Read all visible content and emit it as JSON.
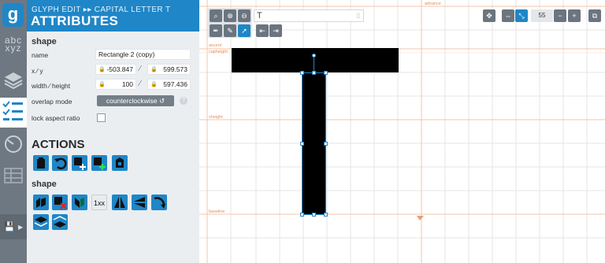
{
  "rail": {
    "logo": "g",
    "items": [
      "abc xyz",
      "layers",
      "attributes",
      "guides",
      "kerning",
      "save"
    ]
  },
  "header": {
    "breadcrumb": "GLYPH EDIT  ▸▸  CAPITAL LETTER T",
    "title": "ATTRIBUTES"
  },
  "shape_section": {
    "heading": "shape",
    "name_label": "name",
    "name_value": "Rectangle 2 (copy)",
    "xy_label": "x ⁄ y",
    "x_value": "-503.847",
    "y_value": "599.573",
    "wh_label": "width ⁄ height",
    "width_value": "100",
    "height_value": "597.436",
    "overlap_label": "overlap mode",
    "overlap_value": "counterclockwise ↺",
    "lock_label": "lock aspect ratio",
    "lock_checked": false
  },
  "actions": {
    "heading": "ACTIONS",
    "shape_heading": "shape",
    "shape_action_text": "1xx"
  },
  "canvas": {
    "char_input": "T",
    "zoom": "55",
    "guides": {
      "top_label": "advance",
      "ascent_label": "ascent",
      "cap_label": "capheight",
      "xheight_label": "xheight",
      "baseline_label": "baseline"
    },
    "glyph_color": "#000000",
    "accent": "#1f86c7"
  }
}
